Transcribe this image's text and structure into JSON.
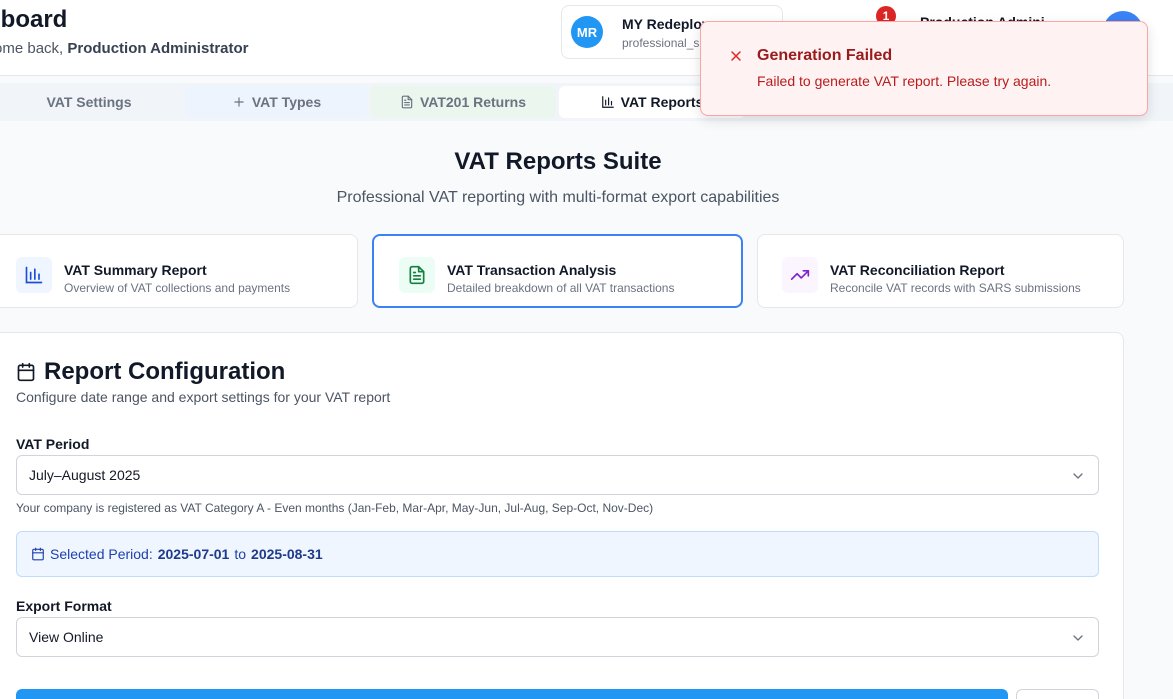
{
  "header": {
    "title": "hboard",
    "welcome_prefix": "ome back,",
    "welcome_name": "Production Administrator",
    "company": {
      "initials": "MR",
      "name": "MY Redeploy",
      "role": "professional_s"
    },
    "notification_count": "1",
    "user_name": "Production Admini"
  },
  "tabs": [
    {
      "label": "VAT Settings",
      "icon": ""
    },
    {
      "label": "VAT Types",
      "icon": "plus-icon"
    },
    {
      "label": "VAT201 Returns",
      "icon": "file-text-icon"
    },
    {
      "label": "VAT Reports",
      "icon": "bar-chart-icon",
      "active": true
    }
  ],
  "suite": {
    "title": "VAT Reports Suite",
    "subtitle": "Professional VAT reporting with multi-format export capabilities"
  },
  "report_cards": [
    {
      "title": "VAT Summary Report",
      "description": "Overview of VAT collections and payments",
      "icon": "bar-chart-icon",
      "color": "#1d4ed8"
    },
    {
      "title": "VAT Transaction Analysis",
      "description": "Detailed breakdown of all VAT transactions",
      "icon": "file-text-icon",
      "color": "#15803d",
      "selected": true
    },
    {
      "title": "VAT Reconciliation Report",
      "description": "Reconcile VAT records with SARS submissions",
      "icon": "trending-up-icon",
      "color": "#7e22ce"
    }
  ],
  "config": {
    "title": "Report Configuration",
    "subtitle": "Configure date range and export settings for your VAT report",
    "vat_period": {
      "label": "VAT Period",
      "value": "July–August 2025",
      "hint": "Your company is registered as VAT Category A - Even months (Jan-Feb, Mar-Apr, May-Jun, Jul-Aug, Sep-Oct, Nov-Dec)"
    },
    "selected_period": {
      "prefix": "Selected Period:",
      "start": "2025-07-01",
      "connector": "to",
      "end": "2025-08-31"
    },
    "export_format": {
      "label": "Export Format",
      "value": "View Online"
    }
  },
  "toast": {
    "title": "Generation Failed",
    "message": "Failed to generate VAT report. Please try again."
  },
  "colors": {
    "accent": "#2196f3",
    "selected_border": "#3b82f6",
    "error": "#dc2626"
  }
}
